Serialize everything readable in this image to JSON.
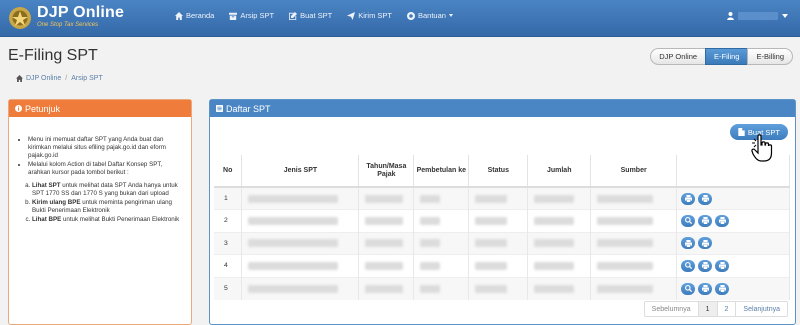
{
  "brand": {
    "name": "DJP Online",
    "tagline": "One Stop Tax Services"
  },
  "nav": [
    {
      "label": "Beranda",
      "icon": "home-icon"
    },
    {
      "label": "Arsip SPT",
      "icon": "archive-icon"
    },
    {
      "label": "Buat SPT",
      "icon": "edit-icon"
    },
    {
      "label": "Kirim SPT",
      "icon": "send-icon"
    },
    {
      "label": "Bantuan",
      "icon": "help-icon"
    }
  ],
  "page_title": "E-Filing SPT",
  "switch": [
    "DJP Online",
    "E-Filing",
    "E-Billing"
  ],
  "switch_active": "E-Filing",
  "breadcrumb": [
    "DJP Online",
    "Arsip SPT"
  ],
  "petunjuk": {
    "title": "Petunjuk",
    "bullets": [
      "Menu ini memuat daftar SPT yang Anda buat dan kirimkan melalui situs efiling pajak.go.id dan eform pajak.go.id",
      "Melalui kolom Action di tabel Daftar Konsep SPT, arahkan kursor pada tombol berikut :"
    ],
    "items": [
      {
        "bold": "Lihat SPT",
        "text": " untuk melihat data SPT Anda hanya untuk SPT 1770 SS dan 1770 S yang bukan dari upload"
      },
      {
        "bold": "Kirim ulang BPE",
        "text": " untuk meminta pengiriman ulang Bukti Penerimaan Elektronik"
      },
      {
        "bold": "Lihat BPE",
        "text": " untuk melihat Bukti Penerimaan Elektronik"
      }
    ]
  },
  "daftar": {
    "title": "Daftar SPT",
    "buat_label": "Buat SPT",
    "columns": [
      "No",
      "Jenis SPT",
      "Tahun/Masa Pajak",
      "Pembetulan ke",
      "Status",
      "Jumlah",
      "Sumber",
      ""
    ],
    "rows": [
      {
        "no": "1",
        "actions": 2
      },
      {
        "no": "2",
        "actions": 3
      },
      {
        "no": "3",
        "actions": 2
      },
      {
        "no": "4",
        "actions": 3
      },
      {
        "no": "5",
        "actions": 3
      }
    ]
  },
  "pager": {
    "prev": "Sebelumnya",
    "pages": [
      "1",
      "2"
    ],
    "active": "1",
    "next": "Selanjutnya"
  },
  "colors": {
    "navbar": "#3f77b8",
    "accent": "#4a86c4",
    "orange": "#ef7c3a"
  }
}
